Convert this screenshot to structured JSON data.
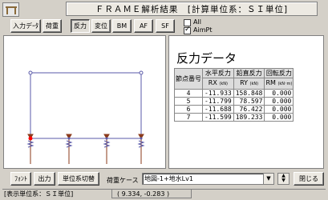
{
  "window": {
    "title": "ＦＲＡＭＥ解析結果　[計算単位系：ＳＩ単位]"
  },
  "toolbar": {
    "input_data": "入力デｰﾀ",
    "load": "荷重",
    "tabs": [
      {
        "label": "反力",
        "active": true
      },
      {
        "label": "変位",
        "active": false
      },
      {
        "label": "BM",
        "active": false
      },
      {
        "label": "AF",
        "active": false
      },
      {
        "label": "SF",
        "active": false
      }
    ],
    "check_all": {
      "label": "All",
      "checked": false
    },
    "check_aimpt": {
      "label": "AimPt",
      "checked": true
    }
  },
  "result": {
    "title": "反力データ",
    "headers": {
      "node": "節点番号",
      "h": {
        "name": "水平反力",
        "sym": "R",
        "sub": "X",
        "unit": "(kN)"
      },
      "v": {
        "name": "鉛直反力",
        "sym": "R",
        "sub": "Y",
        "unit": "(kN)"
      },
      "m": {
        "name": "回転反力",
        "sym": "R",
        "sub": "M",
        "unit": "(kN･m)"
      }
    },
    "rows": [
      {
        "node": "4",
        "rx": "-11.933",
        "ry": "158.848",
        "rm": "0.000"
      },
      {
        "node": "5",
        "rx": "-11.799",
        "ry": "78.597",
        "rm": "0.000"
      },
      {
        "node": "6",
        "rx": "-11.688",
        "ry": "76.422",
        "rm": "0.000"
      },
      {
        "node": "7",
        "rx": "-11.599",
        "ry": "189.233",
        "rm": "0.000"
      }
    ]
  },
  "bottom": {
    "font_btn": "ﾌｫﾝﾄ",
    "output_btn": "出力",
    "unit_btn": "単位系切替",
    "case_label": "荷重ケース",
    "case_value": "地図-1+地水Lv1",
    "close_btn": "閉じる"
  },
  "status": {
    "unit_text": "[表示単位系：ＳＩ単位]",
    "coords": "( 9.334, -0.283 )"
  },
  "colors": {
    "frame": "#5a5aa8",
    "support": "#8b3a1a",
    "node_dot": "#ff0000"
  }
}
